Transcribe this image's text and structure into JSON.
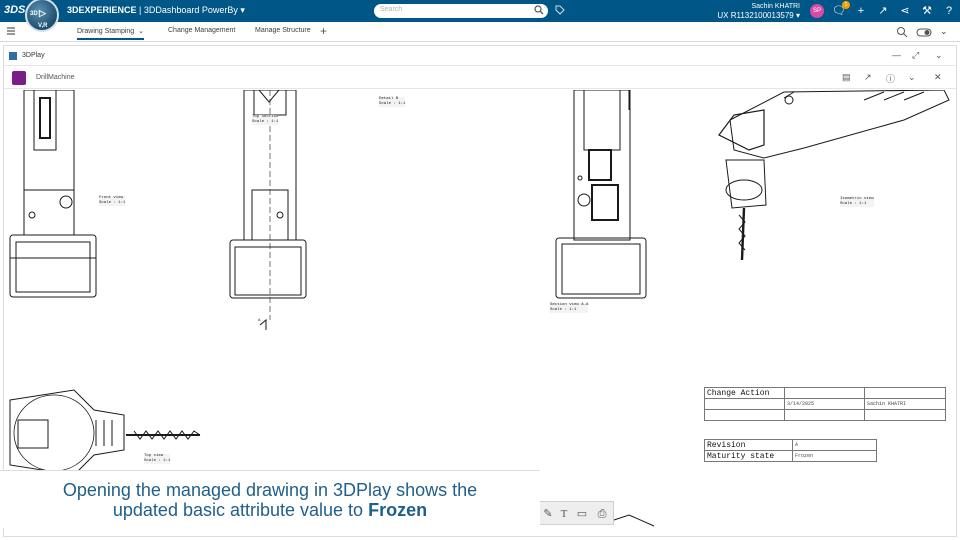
{
  "topbar": {
    "ds_logo": "3DS",
    "compass_labels": [
      "3D",
      "V,R"
    ],
    "brand_bold": "3DEXPERIENCE",
    "brand_rest": " | 3DDashboard  PowerBy",
    "search_placeholder": "Search",
    "user_name": "Sachin KHATRI",
    "user_ux": "UX R1132100013579",
    "avatar_initials": "SP",
    "notification_count": "1"
  },
  "tabs": [
    {
      "label": "Drawing Stamping"
    },
    {
      "label": "Change Management"
    },
    {
      "label": "Manage Structure"
    }
  ],
  "widget": {
    "title": "3DPlay",
    "document_title": "DrillMachine"
  },
  "drawing": {
    "view_labels": [
      "Front view\nScale : 1:1",
      "Top Section\nScale : 1:1",
      "Detail B\nScale : 1:1",
      "Section view A-A\nScale : 1:1",
      "Isometric view\nScale : 1:1",
      "Top view\nScale : 1:1"
    ],
    "section_marker": "A"
  },
  "change_table": {
    "header": "Change Action",
    "date": "3/14/2025",
    "author": "Sachin KHATRI"
  },
  "revision_table": {
    "revision_label": "Revision",
    "revision_value": "A",
    "maturity_label": "Maturity state",
    "maturity_value": "Frozen"
  },
  "caption": {
    "line1": "Opening the managed drawing in 3DPlay shows the",
    "line2_prefix": "updated basic attribute value to ",
    "line2_bold": "Frozen"
  },
  "colors": {
    "topbar": "#005686",
    "caption_text": "#1f5f8b",
    "doc_icon": "#7b1c8a"
  }
}
